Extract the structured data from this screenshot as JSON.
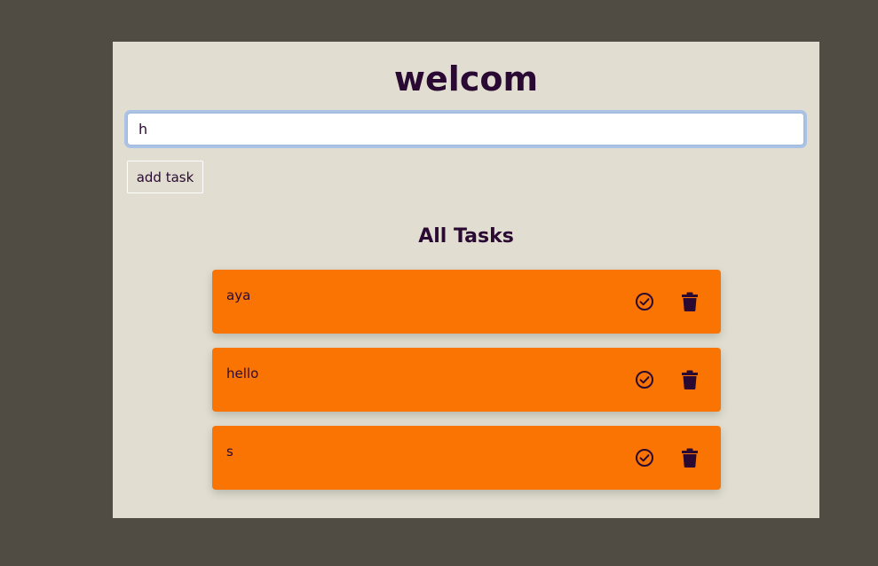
{
  "header": {
    "title": "welcom"
  },
  "input": {
    "value": "h"
  },
  "actions": {
    "add_label": "add task"
  },
  "tasks_section": {
    "title": "All Tasks"
  },
  "tasks": [
    {
      "text": "aya"
    },
    {
      "text": "hello"
    },
    {
      "text": "s"
    }
  ],
  "icons": {
    "complete": "check-circle-icon",
    "delete": "trash-icon"
  },
  "colors": {
    "background": "#504b43",
    "card": "#e1ded1",
    "task": "#f97402",
    "text": "#2a0a33"
  }
}
